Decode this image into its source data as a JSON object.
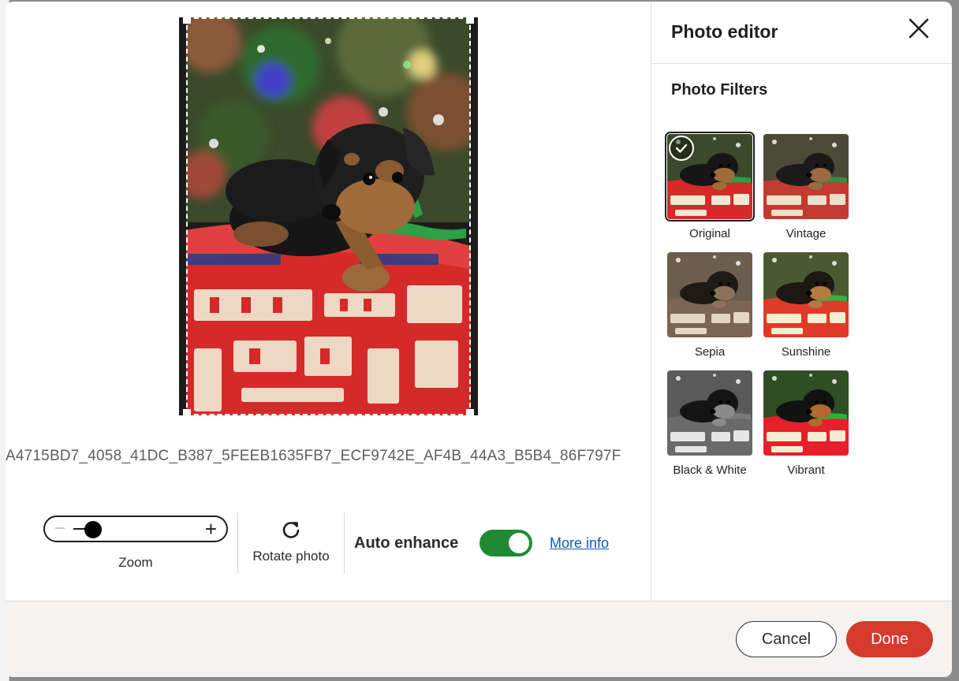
{
  "sidebar": {
    "title": "Photo editor",
    "close_icon": "close-icon",
    "filters_title": "Photo Filters",
    "filters": [
      {
        "label": "Original",
        "selected": true,
        "tone": "original"
      },
      {
        "label": "Vintage",
        "selected": false,
        "tone": "vintage"
      },
      {
        "label": "Sepia",
        "selected": false,
        "tone": "sepia"
      },
      {
        "label": "Sunshine",
        "selected": false,
        "tone": "sunshine"
      },
      {
        "label": "Black & White",
        "selected": false,
        "tone": "bw"
      },
      {
        "label": "Vibrant",
        "selected": false,
        "tone": "vibrant"
      }
    ]
  },
  "editor": {
    "file_name": "A4715BD7_4058_41DC_B387_5FEEB1635FB7_ECF9742E_AF4B_44A3_B5B4_86F797F",
    "zoom": {
      "label": "Zoom",
      "value_fraction": 0.12,
      "minus_icon": "minus-icon",
      "plus_icon": "plus-icon"
    },
    "rotate": {
      "label": "Rotate photo",
      "icon": "rotate-icon"
    },
    "auto_enhance": {
      "label": "Auto enhance",
      "enabled": true,
      "more_info": "More info"
    }
  },
  "footer": {
    "cancel_label": "Cancel",
    "done_label": "Done"
  },
  "colors": {
    "accent_done": "#d63a2c",
    "toggle_on": "#1f8a32",
    "link": "#0a5db4"
  }
}
